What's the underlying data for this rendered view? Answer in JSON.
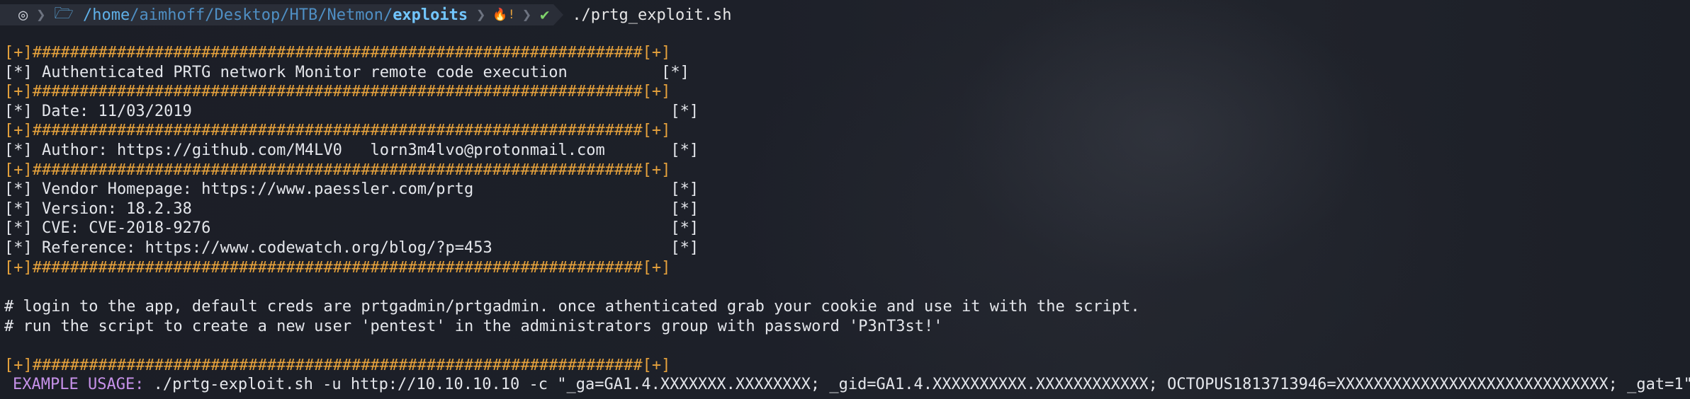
{
  "prompt": {
    "os_icon": "◎",
    "path_home": "/home",
    "path_sep": "/",
    "path_user": "aimhoff",
    "path_desktop": "Desktop",
    "path_htb": "HTB",
    "path_netmon": "Netmon",
    "path_last": "exploits",
    "fire_icon": "🔥!",
    "check_icon": "✔",
    "command": "./prtg_exploit.sh"
  },
  "banner": {
    "border": "[+]#################################################################[+]",
    "lines": [
      "[*] Authenticated PRTG network Monitor remote code execution          [*]",
      "[*] Date: 11/03/2019                                                   [*]",
      "[*] Author: https://github.com/M4LV0   lorn3m4lvo@protonmail.com       [*]",
      "[*] Vendor Homepage: https://www.paessler.com/prtg                     [*]",
      "[*] Version: 18.2.38                                                   [*]",
      "[*] CVE: CVE-2018-9276                                                 [*]",
      "[*] Reference: https://www.codewatch.org/blog/?p=453                   [*]"
    ]
  },
  "comments": [
    "# login to the app, default creds are prtgadmin/prtgadmin. once athenticated grab your cookie and use it with the script.",
    "# run the script to create a new user 'pentest' in the administrators group with password 'P3nT3st!'"
  ],
  "usage": {
    "label": "EXAMPLE USAGE:",
    "text": " ./prtg-exploit.sh -u http://10.10.10.10 -c \"_ga=GA1.4.XXXXXXX.XXXXXXXX; _gid=GA1.4.XXXXXXXXXX.XXXXXXXXXXXX; OCTOPUS1813713946=XXXXXXXXXXXXXXXXXXXXXXXXXXXXX; _gat=1\""
  }
}
